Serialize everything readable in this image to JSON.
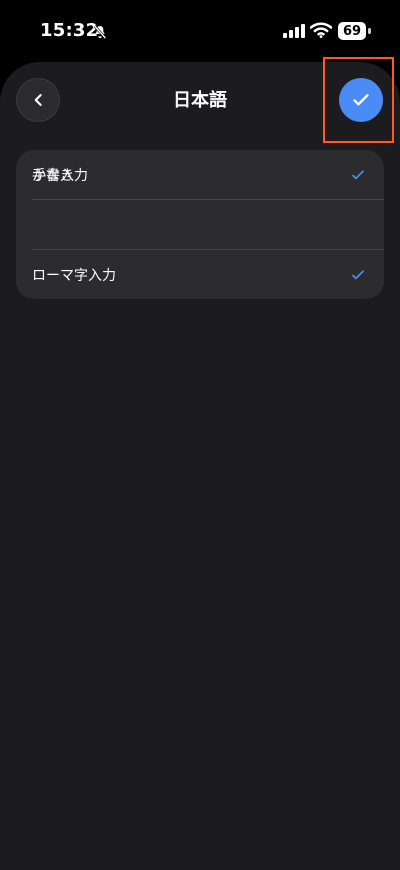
{
  "status_bar": {
    "time": "15:32",
    "battery": "69",
    "icons": [
      "bell-slash-icon",
      "cellular-signal-icon",
      "wifi-icon",
      "battery-icon"
    ]
  },
  "header": {
    "title": "日本語",
    "back_icon": "chevron-left-icon",
    "done_icon": "checkmark-icon",
    "accent_color": "#4a8bf5"
  },
  "options": [
    {
      "label": "かな入力",
      "checked": true
    },
    {
      "label": "ローマ字入力",
      "checked": true
    },
    {
      "label": "手書き",
      "checked": false
    }
  ],
  "annotation": {
    "highlight_color": "#ff5a1f"
  }
}
